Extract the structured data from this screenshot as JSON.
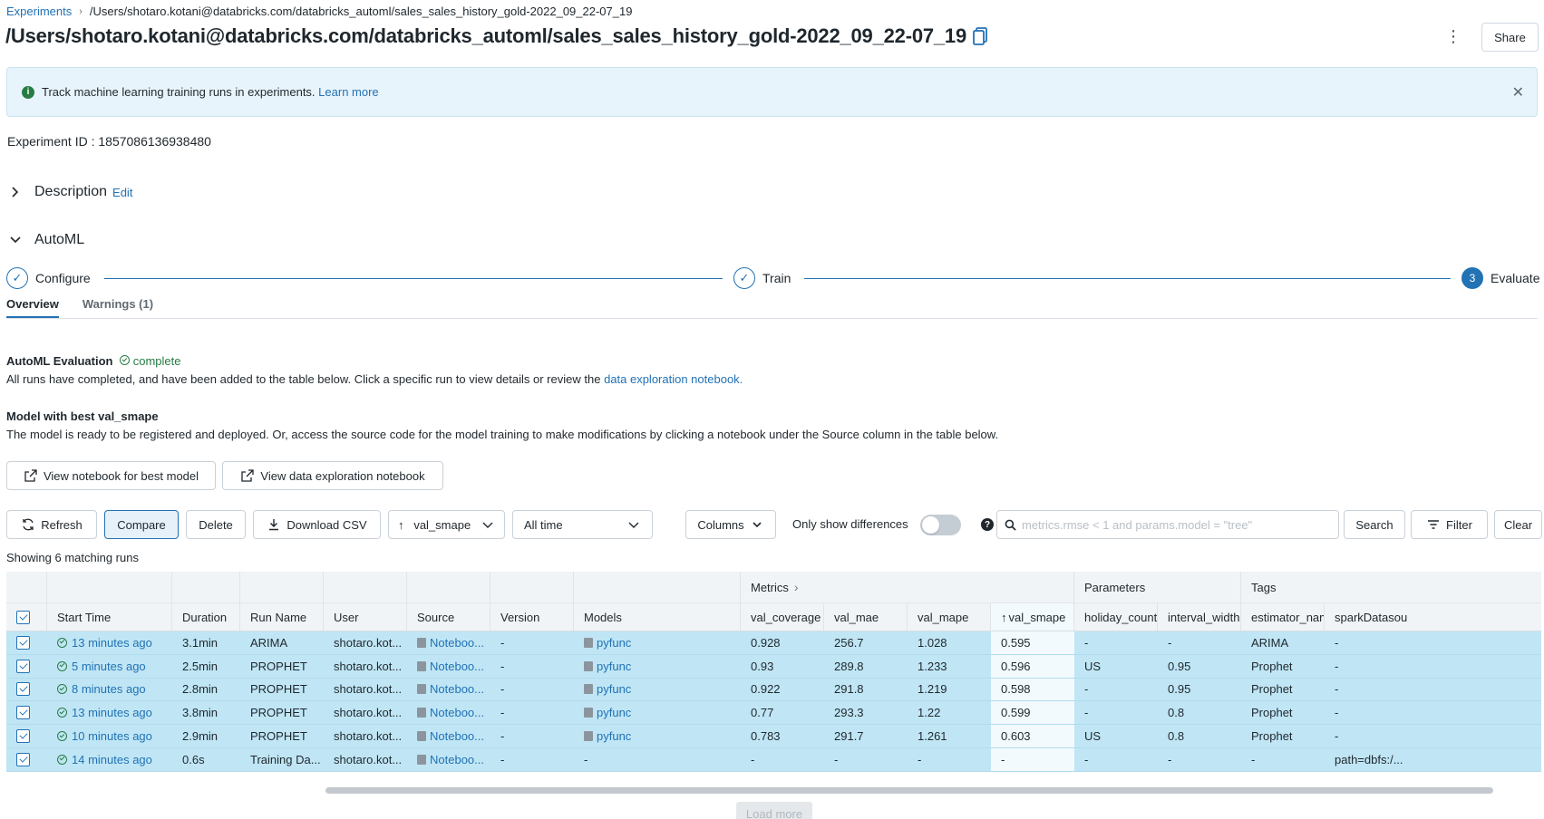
{
  "breadcrumb": {
    "root": "Experiments",
    "path": "/Users/shotaro.kotani@databricks.com/databricks_automl/sales_sales_history_gold-2022_09_22-07_19"
  },
  "title": "/Users/shotaro.kotani@databricks.com/databricks_automl/sales_sales_history_gold-2022_09_22-07_19",
  "share_label": "Share",
  "banner": {
    "text": "Track machine learning training runs in experiments.",
    "link": "Learn more"
  },
  "experiment_id": {
    "label": "Experiment ID :",
    "value": "1857086136938480"
  },
  "description": {
    "label": "Description",
    "edit": "Edit"
  },
  "automl": {
    "label": "AutoML",
    "steps": [
      {
        "label": "Configure",
        "state": "done"
      },
      {
        "label": "Train",
        "state": "done"
      },
      {
        "number": "3",
        "label": "Evaluate",
        "state": "active"
      }
    ],
    "tabs": [
      {
        "label": "Overview",
        "active": true
      },
      {
        "label": "Warnings (1)",
        "active": false
      }
    ],
    "eval_title": "AutoML Evaluation",
    "eval_status": "complete",
    "eval_text": "All runs have completed, and have been added to the table below. Click a specific run to view details or review the",
    "eval_link": "data exploration notebook.",
    "best_title": "Model with best val_smape",
    "best_text": "The model is ready to be registered and deployed. Or, access the source code for the model training to make modifications by clicking a notebook under the Source column in the table below.",
    "btn_best": "View notebook for best model",
    "btn_explore": "View data exploration notebook"
  },
  "toolbar": {
    "refresh": "Refresh",
    "compare": "Compare",
    "delete": "Delete",
    "download": "Download CSV",
    "sort": "val_smape",
    "time": "All time",
    "columns": "Columns",
    "diff_label": "Only show differences",
    "search_placeholder": "metrics.rmse < 1 and params.model = \"tree\"",
    "search": "Search",
    "filter": "Filter",
    "clear": "Clear"
  },
  "showing": "Showing 6 matching runs",
  "table": {
    "groups": {
      "metrics": "Metrics",
      "parameters": "Parameters",
      "tags": "Tags"
    },
    "headers": [
      "Start Time",
      "Duration",
      "Run Name",
      "User",
      "Source",
      "Version",
      "Models",
      "val_coverage",
      "val_mae",
      "val_mape",
      "val_smape",
      "holiday_countr",
      "interval_width",
      "estimator_nam",
      "sparkDatasou"
    ],
    "rows": [
      [
        "13 minutes ago",
        "3.1min",
        "ARIMA",
        "shotaro.kot...",
        "Noteboo...",
        "-",
        "pyfunc",
        "0.928",
        "256.7",
        "1.028",
        "0.595",
        "-",
        "-",
        "ARIMA",
        "-"
      ],
      [
        "5 minutes ago",
        "2.5min",
        "PROPHET",
        "shotaro.kot...",
        "Noteboo...",
        "-",
        "pyfunc",
        "0.93",
        "289.8",
        "1.233",
        "0.596",
        "US",
        "0.95",
        "Prophet",
        "-"
      ],
      [
        "8 minutes ago",
        "2.8min",
        "PROPHET",
        "shotaro.kot...",
        "Noteboo...",
        "-",
        "pyfunc",
        "0.922",
        "291.8",
        "1.219",
        "0.598",
        "-",
        "0.95",
        "Prophet",
        "-"
      ],
      [
        "13 minutes ago",
        "3.8min",
        "PROPHET",
        "shotaro.kot...",
        "Noteboo...",
        "-",
        "pyfunc",
        "0.77",
        "293.3",
        "1.22",
        "0.599",
        "-",
        "0.8",
        "Prophet",
        "-"
      ],
      [
        "10 minutes ago",
        "2.9min",
        "PROPHET",
        "shotaro.kot...",
        "Noteboo...",
        "-",
        "pyfunc",
        "0.783",
        "291.7",
        "1.261",
        "0.603",
        "US",
        "0.8",
        "Prophet",
        "-"
      ],
      [
        "14 minutes ago",
        "0.6s",
        "Training Da...",
        "shotaro.kot...",
        "Noteboo...",
        "-",
        "-",
        "-",
        "-",
        "-",
        "-",
        "-",
        "-",
        "-",
        "path=dbfs:/..."
      ]
    ]
  },
  "load_more": "Load more",
  "colors": {
    "accent": "#2272b4",
    "success": "#277c43",
    "row_selected": "#c0e6f5"
  }
}
